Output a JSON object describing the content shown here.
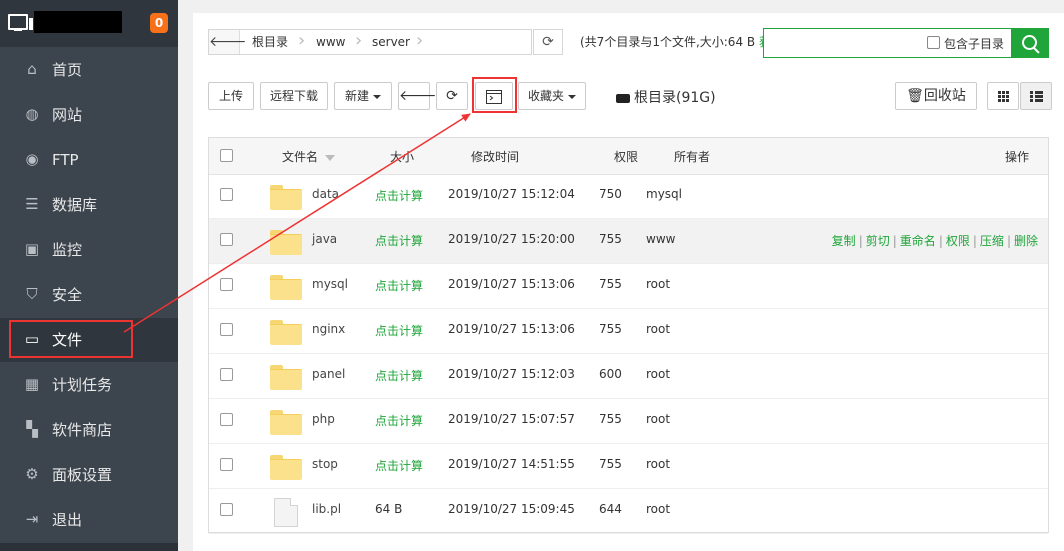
{
  "sidebar": {
    "badge": "0",
    "items": [
      {
        "label": "首页",
        "icon": "home-icon"
      },
      {
        "label": "网站",
        "icon": "globe-icon"
      },
      {
        "label": "FTP",
        "icon": "ftp-icon"
      },
      {
        "label": "数据库",
        "icon": "database-icon"
      },
      {
        "label": "监控",
        "icon": "monitor-chart-icon"
      },
      {
        "label": "安全",
        "icon": "shield-icon"
      },
      {
        "label": "文件",
        "icon": "folder-icon",
        "active": true
      },
      {
        "label": "计划任务",
        "icon": "calendar-icon"
      },
      {
        "label": "软件商店",
        "icon": "apps-icon"
      },
      {
        "label": "面板设置",
        "icon": "gear-icon"
      },
      {
        "label": "退出",
        "icon": "logout-icon"
      }
    ]
  },
  "breadcrumb": [
    "根目录",
    "www",
    "server"
  ],
  "summary": {
    "text": "(共7个目录与1个文件,大小:64 B",
    "link": "获"
  },
  "search": {
    "placeholder": "",
    "subdir_label": "包含子目录"
  },
  "toolbar": {
    "upload": "上传",
    "remote_download": "远程下载",
    "new": "新建",
    "favorites": "收藏夹",
    "disk": "根目录(91G)",
    "recycle": "回收站"
  },
  "table": {
    "headers": {
      "name": "文件名",
      "size": "大小",
      "mtime": "修改时间",
      "perm": "权限",
      "owner": "所有者",
      "ops": "操作"
    },
    "rows": [
      {
        "name": "data",
        "size": "点击计算",
        "mtime": "2019/10/27 15:12:04",
        "perm": "750",
        "owner": "mysql",
        "type": "folder"
      },
      {
        "name": "java",
        "size": "点击计算",
        "mtime": "2019/10/27 15:20:00",
        "perm": "755",
        "owner": "www",
        "type": "folder"
      },
      {
        "name": "mysql",
        "size": "点击计算",
        "mtime": "2019/10/27 15:13:06",
        "perm": "755",
        "owner": "root",
        "type": "folder"
      },
      {
        "name": "nginx",
        "size": "点击计算",
        "mtime": "2019/10/27 15:13:06",
        "perm": "755",
        "owner": "root",
        "type": "folder"
      },
      {
        "name": "panel",
        "size": "点击计算",
        "mtime": "2019/10/27 15:12:03",
        "perm": "600",
        "owner": "root",
        "type": "folder"
      },
      {
        "name": "php",
        "size": "点击计算",
        "mtime": "2019/10/27 15:07:57",
        "perm": "755",
        "owner": "root",
        "type": "folder"
      },
      {
        "name": "stop",
        "size": "点击计算",
        "mtime": "2019/10/27 14:51:55",
        "perm": "755",
        "owner": "root",
        "type": "folder"
      },
      {
        "name": "lib.pl",
        "size": "64 B",
        "mtime": "2019/10/27 15:09:45",
        "perm": "644",
        "owner": "root",
        "type": "file"
      }
    ],
    "row_actions": [
      "复制",
      "剪切",
      "重命名",
      "权限",
      "压缩",
      "删除"
    ]
  },
  "colors": {
    "accent": "#20a53a",
    "sidebar": "#3c444d",
    "highlight": "#ee3333",
    "badge": "#f7711b"
  }
}
